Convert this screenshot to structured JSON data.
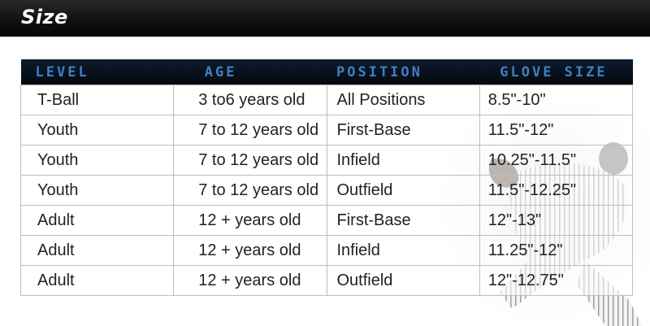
{
  "header": {
    "title": "Size"
  },
  "table": {
    "columns": [
      "LEVEL",
      "AGE",
      "POSITION",
      "GLOVE SIZE"
    ],
    "rows": [
      [
        "T-Ball",
        "3 to6 years old",
        "All Positions",
        "8.5\"-10\""
      ],
      [
        "Youth",
        "7 to 12 years old",
        "First-Base",
        "11.5\"-12\""
      ],
      [
        "Youth",
        "7 to 12 years old",
        "Infield",
        "10.25\"-11.5\""
      ],
      [
        "Youth",
        "7 to 12 years old",
        "Outfield",
        "11.5\"-12.25\""
      ],
      [
        "Adult",
        "12 + years old",
        "First-Base",
        "12\"-13\""
      ],
      [
        "Adult",
        "12 + years old",
        "Infield",
        "11.25\"-12\""
      ],
      [
        "Adult",
        "12 + years old",
        "Outfield",
        "12\"-12.75\""
      ]
    ]
  },
  "colors": {
    "header_bar": "#111111",
    "table_header_bg": "#0a1420",
    "table_header_text": "#3f7fc2",
    "cell_border": "#bdbdbd"
  },
  "decor": {
    "background_image": "baseball-pitcher-figure"
  }
}
